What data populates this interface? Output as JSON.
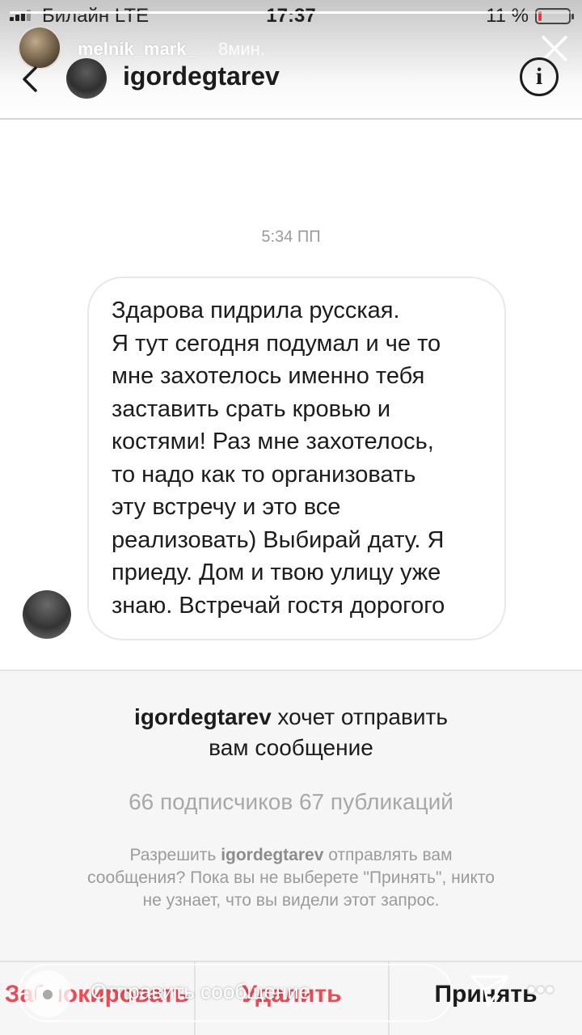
{
  "status_bar": {
    "carrier": "Билайн LTE",
    "time": "17:37",
    "battery_percent_text": "11 %",
    "battery_level": 0.11
  },
  "story": {
    "progress": 0.9,
    "username": "melnik_mark_",
    "posted_ago": "8мин.",
    "close_icon": "close-icon",
    "reply_placeholder": "Отправить сообщение",
    "camera_icon": "camera-icon",
    "send_icon": "paper-plane-icon",
    "more_icon": "more-dots-icon"
  },
  "dm_header": {
    "back_icon": "chevron-left-icon",
    "username": "igordegtarev",
    "info_icon": "info-icon",
    "info_glyph": "i"
  },
  "conversation": {
    "timestamp": "5:34 ПП",
    "message_lines": [
      "Здарова пидрила русская.",
      "Я тут сегодня подумал и че то",
      "мне захотелось именно тебя",
      "заставить срать кровью и",
      "костями! Раз мне захотелось,",
      "то надо как то организовать",
      "эту встречу и это все",
      "реализовать) Выбирай дату. Я",
      "приеду. Дом и твою улицу уже",
      "знаю. Встречай гостя дорогого"
    ]
  },
  "request": {
    "title_username": "igordegtarev",
    "title_rest_line1": " хочет отправить",
    "title_line2": "вам сообщение",
    "stats": "66 подписчиков 67 публикаций",
    "desc_prefix": "Разрешить ",
    "desc_username": "igordegtarev",
    "desc_rest_1": " отправлять вам",
    "desc_line2": "сообщения? Пока вы не выберете \"Принять\", никто",
    "desc_line3": "не узнает, что вы видели этот запрос."
  },
  "actions": {
    "block": "Заблокировать",
    "delete": "Удалить",
    "accept": "Принять"
  },
  "colors": {
    "danger": "#ed4956",
    "text": "#1c1c1c",
    "muted": "#9b9b9b"
  }
}
